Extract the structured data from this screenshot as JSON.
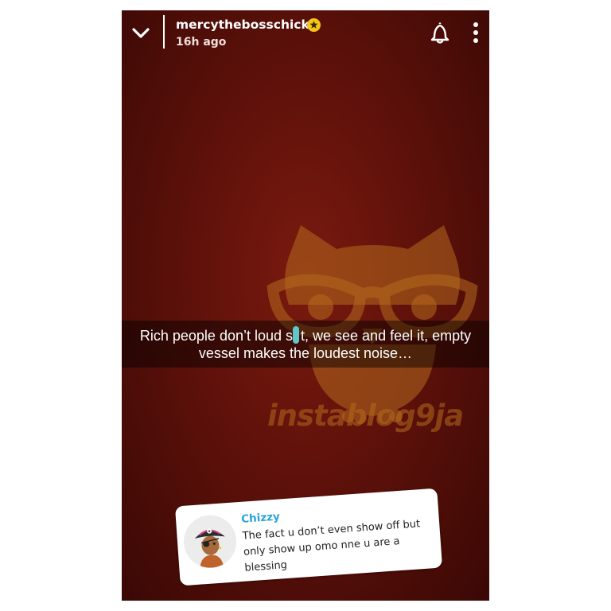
{
  "header": {
    "username": "mercythebosschick",
    "time_ago": "16h ago",
    "icons": [
      "chevron-down-icon",
      "star-badge-icon",
      "bell-icon",
      "more-vertical-icon"
    ]
  },
  "watermark": {
    "text": "instablog9ja"
  },
  "caption": {
    "line1": "Rich people don’t loud s  t, we see and feel it, empty",
    "line2": "vessel makes the loudest noise…"
  },
  "reply": {
    "name": "Chizzy",
    "line1": "The fact u don’t even show off but",
    "line2": "only show up omo nne u are a",
    "line3": "blessing"
  },
  "colors": {
    "background": "#5e110a",
    "accent_name": "#29a3d6",
    "badge": "#f5c518",
    "watermark": "#b46a1e"
  }
}
